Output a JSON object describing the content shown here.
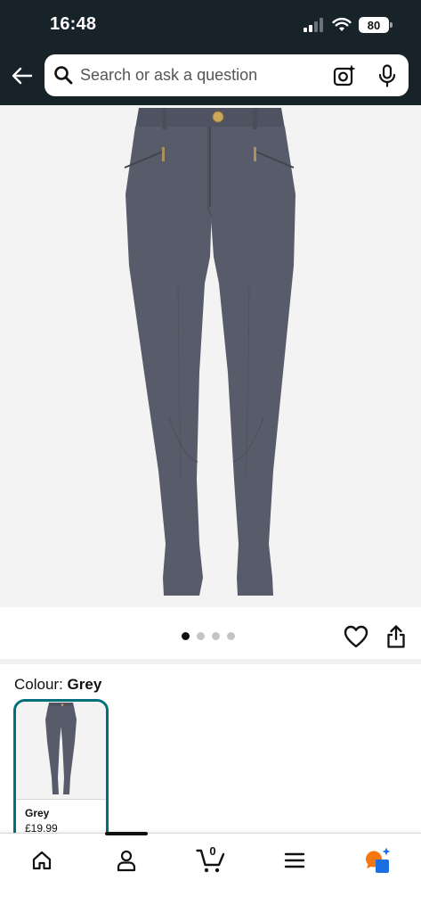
{
  "status_bar": {
    "time": "16:48",
    "battery": "80"
  },
  "search": {
    "placeholder": "Search or ask a question"
  },
  "carousel": {
    "total_images": 4,
    "active_index": 0
  },
  "variation": {
    "label": "Colour: ",
    "selected": "Grey",
    "options": [
      {
        "name": "Grey",
        "price": "£19.99"
      }
    ]
  },
  "bottom_nav": {
    "cart_count": "0"
  },
  "colors": {
    "header_bg": "#172229",
    "selected_border": "#00707a",
    "product": "#585b69",
    "ai_badge_orange": "#f7760f",
    "ai_badge_blue": "#1b6fe3"
  }
}
